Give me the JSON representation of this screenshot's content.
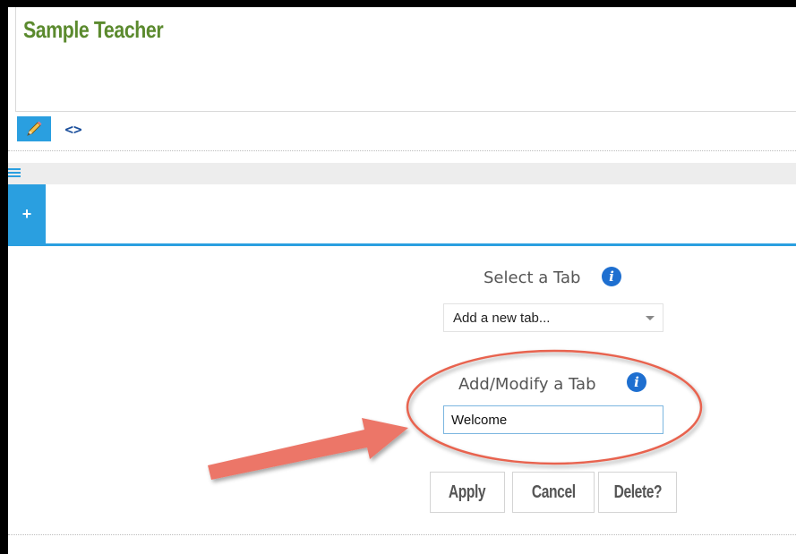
{
  "header": {
    "site_title": "Sample Teacher"
  },
  "edit_toolbar": {
    "pencil_icon": "pencil-icon",
    "code_glyph": "<>"
  },
  "tab_bar": {
    "add_tab_label": "+"
  },
  "select_tab": {
    "label": "Select a Tab",
    "info_glyph": "i",
    "selected_value": "Add a new tab..."
  },
  "modify_tab": {
    "label": "Add/Modify a Tab",
    "info_glyph": "i",
    "input_value": "Welcome"
  },
  "actions": {
    "apply_label": "Apply",
    "cancel_label": "Cancel",
    "delete_label": "Delete?"
  },
  "colors": {
    "accent_blue": "#2a9fe0",
    "title_green": "#5b8a2e",
    "annotation_red": "#e8644f"
  }
}
